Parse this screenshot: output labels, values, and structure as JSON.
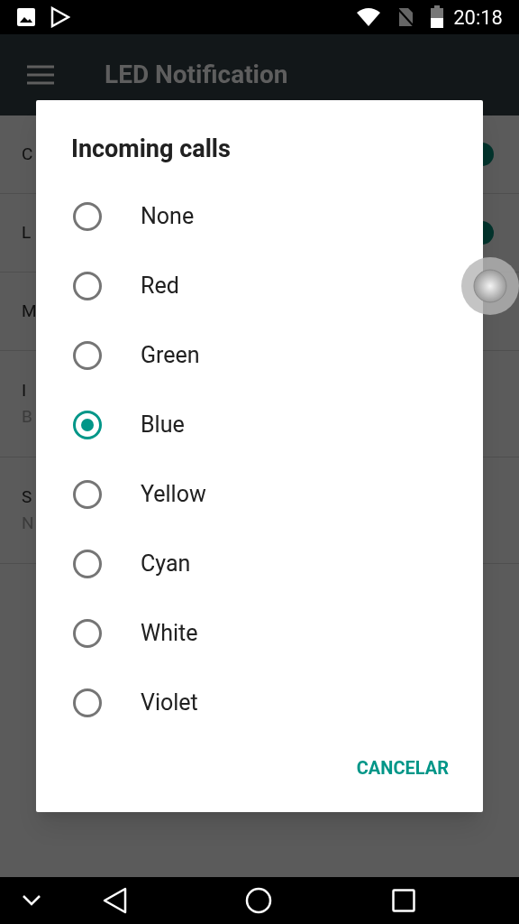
{
  "status_bar": {
    "time": "20:18"
  },
  "app_bar": {
    "title": "LED Notification"
  },
  "background_rows": [
    {
      "title": "C",
      "on": true
    },
    {
      "title": "L",
      "on": true
    },
    {
      "title": "M"
    },
    {
      "title": "I",
      "subtitle": "B"
    },
    {
      "title": "S",
      "subtitle": "N"
    }
  ],
  "dialog": {
    "title": "Incoming calls",
    "options": [
      {
        "label": "None",
        "selected": false
      },
      {
        "label": "Red",
        "selected": false
      },
      {
        "label": "Green",
        "selected": false
      },
      {
        "label": "Blue",
        "selected": true
      },
      {
        "label": "Yellow",
        "selected": false
      },
      {
        "label": "Cyan",
        "selected": false
      },
      {
        "label": "White",
        "selected": false
      },
      {
        "label": "Violet",
        "selected": false
      }
    ],
    "cancel_button": "CANCELAR"
  }
}
